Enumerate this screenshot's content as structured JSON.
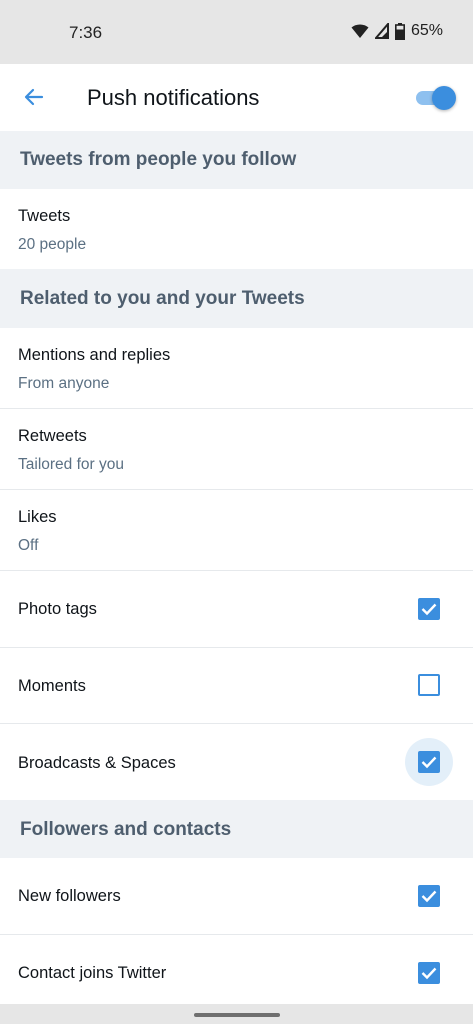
{
  "status_bar": {
    "time": "7:36",
    "battery": "65%"
  },
  "header": {
    "title": "Push notifications",
    "toggle_on": true
  },
  "sections": {
    "follow": {
      "title": "Tweets from people you follow"
    },
    "related": {
      "title": "Related to you and your Tweets"
    },
    "followers": {
      "title": "Followers and contacts"
    }
  },
  "rows": {
    "tweets": {
      "title": "Tweets",
      "subtitle": "20 people"
    },
    "mentions": {
      "title": "Mentions and replies",
      "subtitle": "From anyone"
    },
    "retweets": {
      "title": "Retweets",
      "subtitle": "Tailored for you"
    },
    "likes": {
      "title": "Likes",
      "subtitle": "Off"
    },
    "photo_tags": {
      "title": "Photo tags",
      "checked": true
    },
    "moments": {
      "title": "Moments",
      "checked": false
    },
    "broadcasts": {
      "title": "Broadcasts & Spaces",
      "checked": true
    },
    "new_followers": {
      "title": "New followers",
      "checked": true
    },
    "contact_joins": {
      "title": "Contact joins Twitter",
      "checked": true
    }
  },
  "icons": {
    "back": "arrow-left-icon",
    "wifi": "wifi-icon",
    "signal": "cell-signal-icon",
    "battery": "battery-icon",
    "check": "check-icon"
  },
  "colors": {
    "accent": "#3b8ede",
    "section_bg": "#eff2f5",
    "section_text": "#4e5e6e",
    "secondary_text": "#5b7083"
  }
}
